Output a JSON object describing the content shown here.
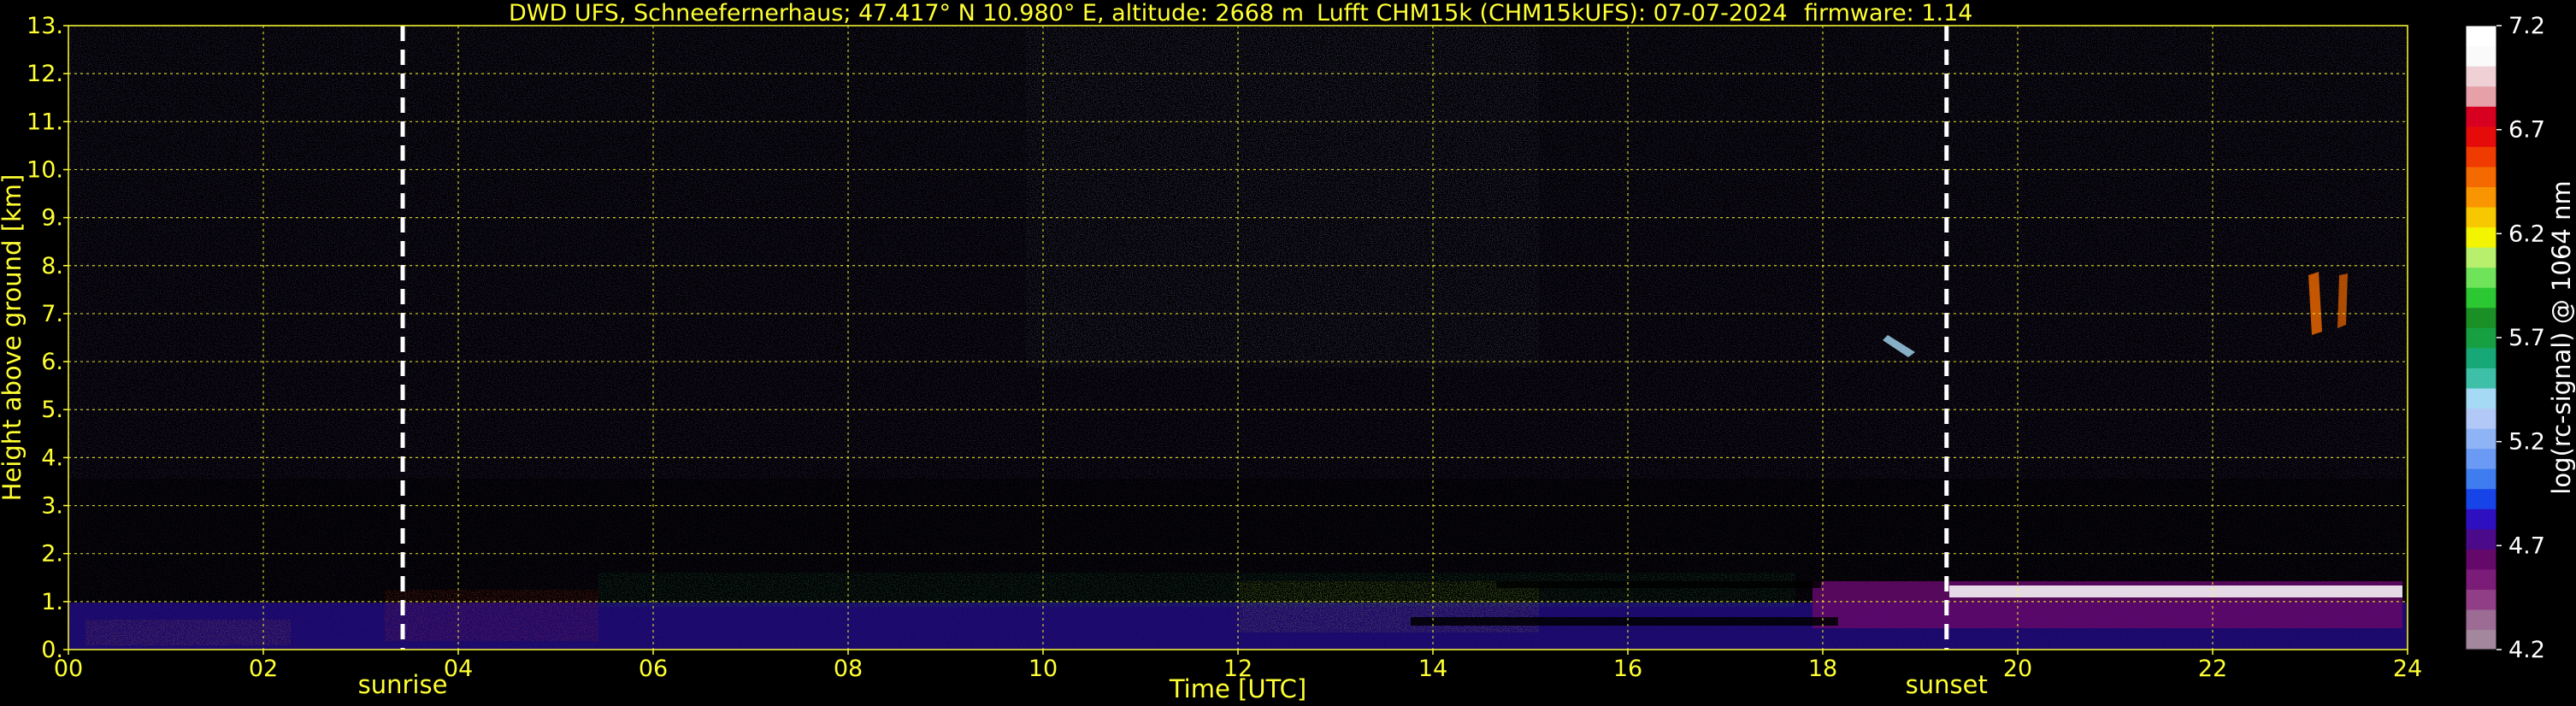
{
  "header": {
    "site": "DWD UFS, Schneefernerhaus; 47.417° N 10.980° E, altitude: 2668 m",
    "instrument": "Lufft CHM15k (CHM15kUFS): 07-07-2024",
    "firmware": "firmware: 1.14"
  },
  "chart_data": {
    "type": "heatmap",
    "title": "DWD UFS, Schneefernerhaus; 47.417° N 10.980° E, altitude: 2668 m    Lufft CHM15k (CHM15kUFS): 07-07-2024    firmware: 1.14",
    "xlabel": "Time [UTC]",
    "ylabel": "Height above ground [km]",
    "colorbar_label": "log(rc-signal) @ 1064 nm",
    "xlim": [
      0,
      24
    ],
    "ylim": [
      0,
      13
    ],
    "x_ticks": [
      "00",
      "02",
      "04",
      "06",
      "08",
      "10",
      "12",
      "14",
      "16",
      "18",
      "20",
      "22",
      "24"
    ],
    "x_tick_values": [
      0,
      2,
      4,
      6,
      8,
      10,
      12,
      14,
      16,
      18,
      20,
      22,
      24
    ],
    "y_ticks": [
      "0.",
      "1.",
      "2.",
      "3.",
      "4.",
      "5.",
      "6.",
      "7.",
      "8.",
      "9.",
      "10.",
      "11.",
      "12.",
      "13."
    ],
    "y_tick_values": [
      0,
      1,
      2,
      3,
      4,
      5,
      6,
      7,
      8,
      9,
      10,
      11,
      12,
      13
    ],
    "colorbar_range": [
      4.2,
      7.2
    ],
    "colorbar_ticks": [
      "4.2",
      "4.7",
      "5.2",
      "5.7",
      "6.2",
      "6.7",
      "7.2"
    ],
    "colorbar_tick_values": [
      4.2,
      4.7,
      5.2,
      5.7,
      6.2,
      6.7,
      7.2
    ],
    "colorbar_colors": [
      "#a3879d",
      "#9c6c94",
      "#903f86",
      "#7b1c78",
      "#64086a",
      "#4a0a8a",
      "#2f10c0",
      "#1744e8",
      "#3f7cf0",
      "#6b9af5",
      "#8fb4f6",
      "#b2c8f6",
      "#a6d9f4",
      "#3ebfa8",
      "#17a877",
      "#16a042",
      "#1a8f25",
      "#2bc833",
      "#6fe35a",
      "#b8f06e",
      "#f3f500",
      "#f7c800",
      "#f89500",
      "#f46a00",
      "#ef3a00",
      "#e50b0b",
      "#d80020",
      "#e5a0a8",
      "#efd0d4",
      "#fafafa",
      "#ffffff"
    ],
    "grid": true,
    "markers": [
      {
        "label": "sunrise",
        "x": 3.43
      },
      {
        "label": "sunset",
        "x": 19.27
      }
    ]
  }
}
